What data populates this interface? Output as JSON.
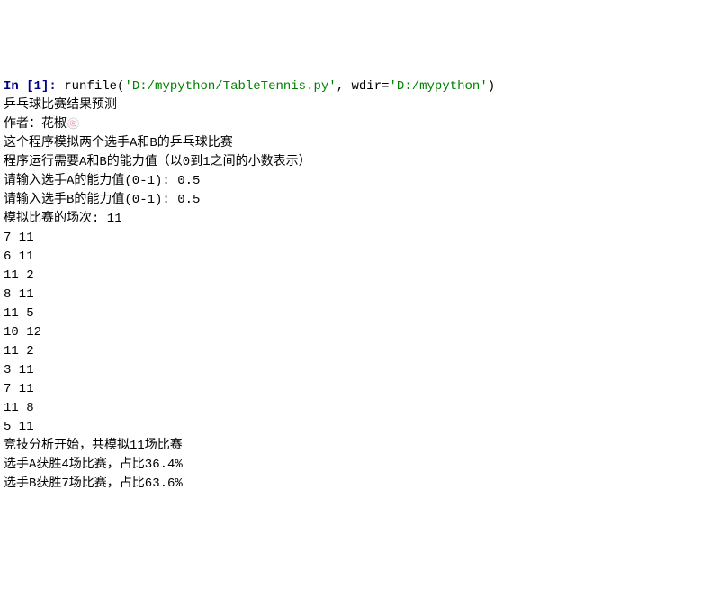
{
  "prompt": {
    "label": "In [",
    "number": "1",
    "suffix": "]: "
  },
  "command": {
    "func": "runfile(",
    "arg1": "'D:/mypython/TableTennis.py'",
    "sep": ", wdir=",
    "arg2": "'D:/mypython'",
    "close": ")"
  },
  "output": {
    "line1": "乒乓球比赛结果预测",
    "line2_prefix": "作者：花椒",
    "line3": "这个程序模拟两个选手A和B的乒乓球比赛",
    "line4": "程序运行需要A和B的能力值（以0到1之间的小数表示）",
    "blank1": "",
    "inputA": "请输入选手A的能力值(0-1): 0.5",
    "blank2": "",
    "inputB": "请输入选手B的能力值(0-1): 0.5",
    "blank3": "",
    "games_label": "模拟比赛的场次: 11",
    "scores": [
      "7 11",
      "6 11",
      "11 2",
      "8 11",
      "11 5",
      "10 12",
      "11 2",
      "3 11",
      "7 11",
      "11 8",
      "5 11"
    ],
    "analysis1": "竞技分析开始，共模拟11场比赛",
    "analysis2": "选手A获胜4场比赛，占比36.4%",
    "analysis3": "选手B获胜7场比赛，占比63.6%"
  }
}
